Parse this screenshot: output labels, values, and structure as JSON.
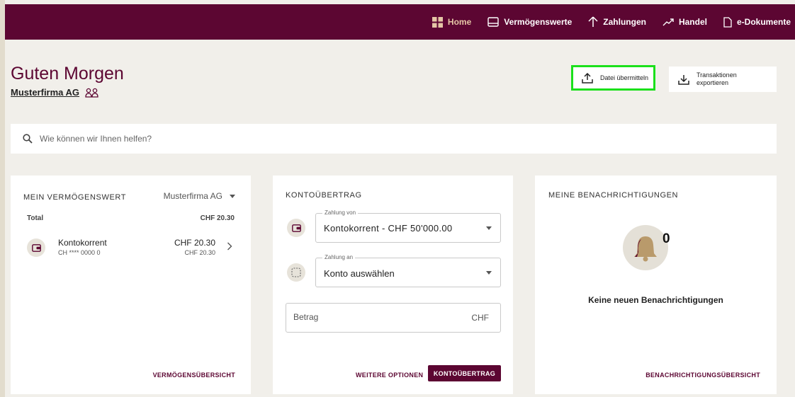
{
  "nav": {
    "items": [
      {
        "label": "Home",
        "icon": "grid-icon",
        "active": true
      },
      {
        "label": "Vermögenswerte",
        "icon": "wallet-icon"
      },
      {
        "label": "Zahlungen",
        "icon": "arrow-up-icon"
      },
      {
        "label": "Handel",
        "icon": "trend-icon"
      },
      {
        "label": "e-Dokumente",
        "icon": "document-icon"
      }
    ]
  },
  "header": {
    "greeting": "Guten Morgen",
    "company": "Musterfirma AG",
    "upload_label": "Datei übermitteln",
    "export_label": "Transaktionen exportieren"
  },
  "search": {
    "placeholder": "Wie können wir Ihnen helfen?"
  },
  "assets": {
    "title": "MEIN VERMÖGENSWERT",
    "entity": "Musterfirma AG",
    "total_label": "Total",
    "total_value": "CHF 20.30",
    "account": {
      "name": "Kontokorrent",
      "iban": "CH **** 0000 0",
      "amount": "CHF 20.30",
      "amount_secondary": "CHF 20.30"
    },
    "footer_link": "VERMÖGENSÜBERSICHT"
  },
  "transfer": {
    "title": "KONTOÜBERTRAG",
    "from_label": "Zahlung von",
    "from_value": "Kontokorrent - CHF 50'000.00",
    "to_label": "Zahlung an",
    "to_value": "Konto auswählen",
    "amount_placeholder": "Betrag",
    "currency": "CHF",
    "more_options": "WEITERE OPTIONEN",
    "submit": "KONTOÜBERTRAG"
  },
  "notifications": {
    "title": "MEINE BENACHRICHTIGUNGEN",
    "count": "0",
    "empty_text": "Keine neuen Benachrichtigungen",
    "footer_link": "BENACHRICHTIGUNGSÜBERSICHT"
  },
  "colors": {
    "brand": "#5c0632",
    "accent": "#e5c6a6",
    "background": "#f1efea",
    "highlight": "#1be01b",
    "bell": "#b99a6b"
  }
}
